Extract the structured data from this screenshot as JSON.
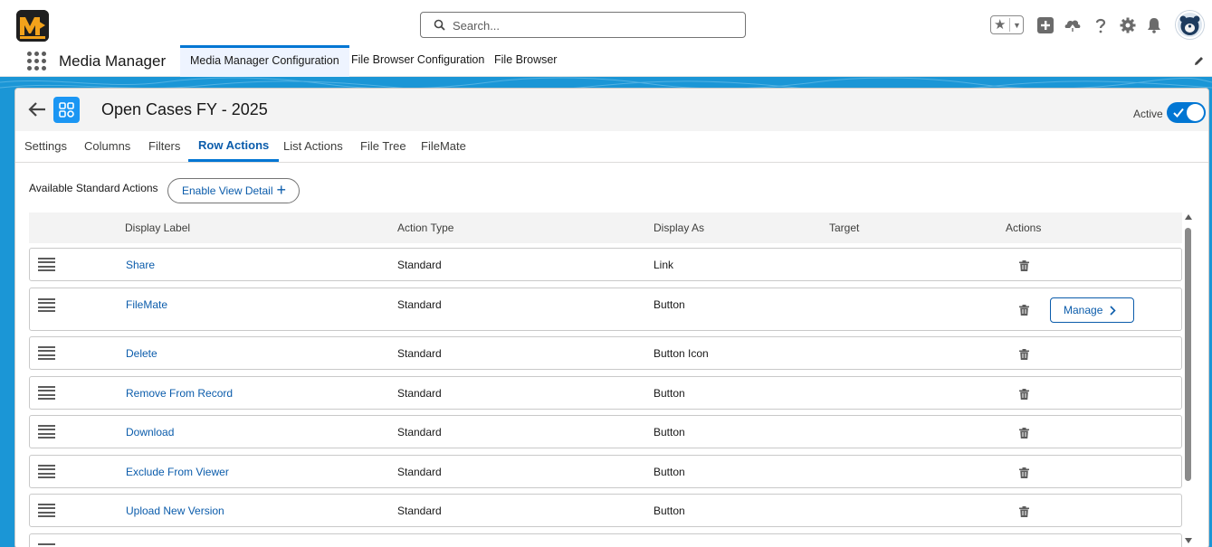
{
  "header": {
    "search_placeholder": "Search...",
    "icons": [
      "favorites-star-icon",
      "add-icon",
      "trailhead-icon",
      "help-icon",
      "setup-gear-icon",
      "notification-bell-icon",
      "avatar"
    ]
  },
  "nav": {
    "app_name": "Media Manager",
    "tabs": [
      {
        "label": "Media Manager Configuration",
        "active": true
      },
      {
        "label": "File Browser Configuration",
        "active": false
      },
      {
        "label": "File Browser",
        "active": false
      }
    ]
  },
  "record": {
    "title": "Open Cases FY - 2025",
    "active_label": "Active",
    "active": true
  },
  "tabs": [
    {
      "label": "Settings"
    },
    {
      "label": "Columns"
    },
    {
      "label": "Filters"
    },
    {
      "label": "Row Actions",
      "active": true
    },
    {
      "label": "List Actions"
    },
    {
      "label": "File Tree"
    },
    {
      "label": "FileMate"
    }
  ],
  "actions_section": {
    "available_label": "Available Standard Actions",
    "enable_button_label": "Enable View Detail"
  },
  "table": {
    "columns": [
      "Display Label",
      "Action Type",
      "Display As",
      "Target",
      "Actions"
    ],
    "rows": [
      {
        "label": "Share",
        "type": "Standard",
        "display_as": "Link",
        "target": ""
      },
      {
        "label": "FileMate",
        "type": "Standard",
        "display_as": "Button",
        "target": "",
        "manage_label": "Manage"
      },
      {
        "label": "Delete",
        "type": "Standard",
        "display_as": "Button Icon",
        "target": ""
      },
      {
        "label": "Remove From Record",
        "type": "Standard",
        "display_as": "Button",
        "target": ""
      },
      {
        "label": "Download",
        "type": "Standard",
        "display_as": "Button",
        "target": ""
      },
      {
        "label": "Exclude From Viewer",
        "type": "Standard",
        "display_as": "Button",
        "target": ""
      },
      {
        "label": "Upload New Version",
        "type": "Standard",
        "display_as": "Button",
        "target": ""
      }
    ]
  },
  "colors": {
    "brand_blue": "#0176d3",
    "link_blue": "#0b5cab",
    "banner_blue": "#1b96d6"
  }
}
